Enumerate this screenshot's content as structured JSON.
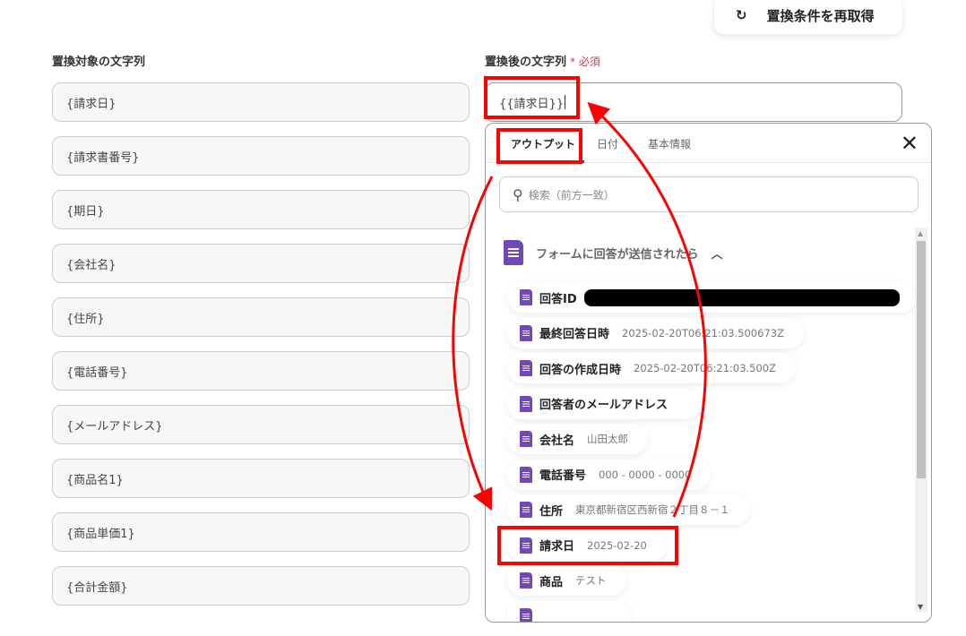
{
  "header": {
    "refetch_label": "置換条件を再取得"
  },
  "left": {
    "label": "置換対象の文字列",
    "fields": [
      "{請求日}",
      "{請求書番号}",
      "{期日}",
      "{会社名}",
      "{住所}",
      "{電話番号}",
      "{メールアドレス}",
      "{商品名1}",
      "{商品単価1}",
      "{合計金額}"
    ]
  },
  "right": {
    "label": "置換後の文字列",
    "required": "必須",
    "value": "{{請求日}}"
  },
  "popup": {
    "tabs": [
      "アウトプット",
      "日付",
      "基本情報"
    ],
    "search_placeholder": "検索（前方一致）",
    "group": "フォームに回答が送信されたら",
    "items": [
      {
        "key": "回答ID",
        "value": ""
      },
      {
        "key": "最終回答日時",
        "value": "2025-02-20T06:21:03.500673Z"
      },
      {
        "key": "回答の作成日時",
        "value": "2025-02-20T06:21:03.500Z"
      },
      {
        "key": "回答者のメールアドレス",
        "value": ""
      },
      {
        "key": "会社名",
        "value": "山田太郎"
      },
      {
        "key": "電話番号",
        "value": "000 - 0000 - 0000"
      },
      {
        "key": "住所",
        "value": "東京都新宿区西新宿２丁目８－１"
      },
      {
        "key": "請求日",
        "value": "2025-02-20"
      },
      {
        "key": "商品",
        "value": "テスト"
      }
    ]
  },
  "colors": {
    "accent": "#1e5f74",
    "form": "#7248b9",
    "annotation": "#ff0000"
  }
}
